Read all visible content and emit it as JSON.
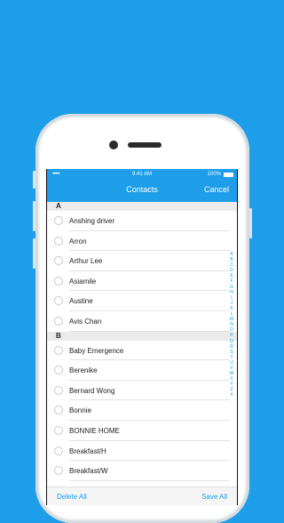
{
  "status_bar": {
    "signal": "•••••",
    "time": "9:41 AM",
    "battery": "100%"
  },
  "nav": {
    "title": "Contacts",
    "cancel_label": "Cancel"
  },
  "sections": [
    {
      "letter": "A",
      "items": [
        "Anshing driver",
        "Arron",
        "Arthur Lee",
        "Asiamile",
        "Austine",
        "Avis Chan"
      ]
    },
    {
      "letter": "B",
      "items": [
        "Baby Emergence",
        "Berenike",
        "Bernard Wong",
        "Bonnie",
        "BONNIE HOME",
        "Breakfast/H",
        "Breakfast/W"
      ]
    }
  ],
  "index_letters": [
    "A",
    "B",
    "C",
    "D",
    "E",
    "F",
    "G",
    "H",
    "I",
    "J",
    "K",
    "L",
    "M",
    "N",
    "O",
    "P",
    "Q",
    "R",
    "S",
    "T",
    "U",
    "V",
    "W",
    "X",
    "Y",
    "Z",
    "#"
  ],
  "footer": {
    "delete_all": "Delete All",
    "save_all": "Save All"
  }
}
